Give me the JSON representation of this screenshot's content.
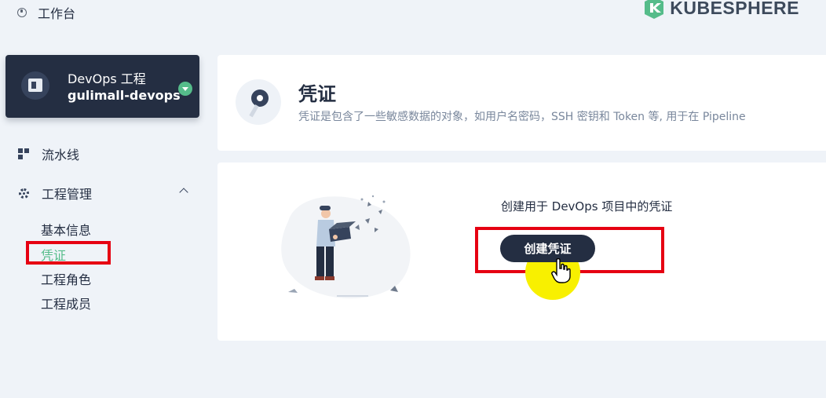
{
  "topbar": {
    "workbench_label": "工作台",
    "logo_text": "KUBESPHERE",
    "brand_color": "#55bc8a"
  },
  "project": {
    "type_label": "DevOps 工程",
    "name": "gulimall-devops",
    "status_icon": "chevron-down-icon",
    "status_color": "#55bc8a"
  },
  "sidebar": {
    "pipeline_label": "流水线",
    "manage_label": "工程管理",
    "sub_items": [
      "基本信息",
      "凭证",
      "工程角色",
      "工程成员"
    ],
    "active_item": "凭证",
    "active_color": "#55bc8a"
  },
  "header": {
    "title": "凭证",
    "description": "凭证是包含了一些敏感数据的对象，如用户名密码，SSH 密钥和 Token 等, 用于在 Pipeline"
  },
  "empty_state": {
    "text": "创建用于 DevOps 项目中的凭证",
    "button_label": "创建凭证"
  },
  "annotation_color": "#e60012"
}
